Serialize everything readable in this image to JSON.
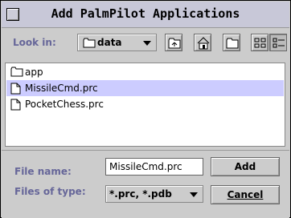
{
  "window": {
    "title": "Add PalmPilot Applications"
  },
  "toolbar": {
    "look_in_label": "Look in:",
    "folder_value": "data",
    "buttons": [
      {
        "icon": "up-folder-icon"
      },
      {
        "icon": "home-icon"
      },
      {
        "icon": "new-folder-icon"
      },
      {
        "icon": "list-view-icon"
      },
      {
        "icon": "details-view-icon"
      }
    ]
  },
  "files": [
    {
      "name": "app",
      "type": "folder",
      "selected": false
    },
    {
      "name": "MissileCmd.prc",
      "type": "file",
      "selected": true
    },
    {
      "name": "PocketChess.prc",
      "type": "file",
      "selected": false
    }
  ],
  "form": {
    "filename_label": "File name:",
    "filename_value": "MissileCmd.prc",
    "filetype_label": "Files of type:",
    "filetype_value": "*.prc, *.pdb",
    "add_label": "Add",
    "cancel_label": "Cancel"
  },
  "colors": {
    "label": "#666699",
    "selection": "#ccccff",
    "window": "#cccccc"
  }
}
